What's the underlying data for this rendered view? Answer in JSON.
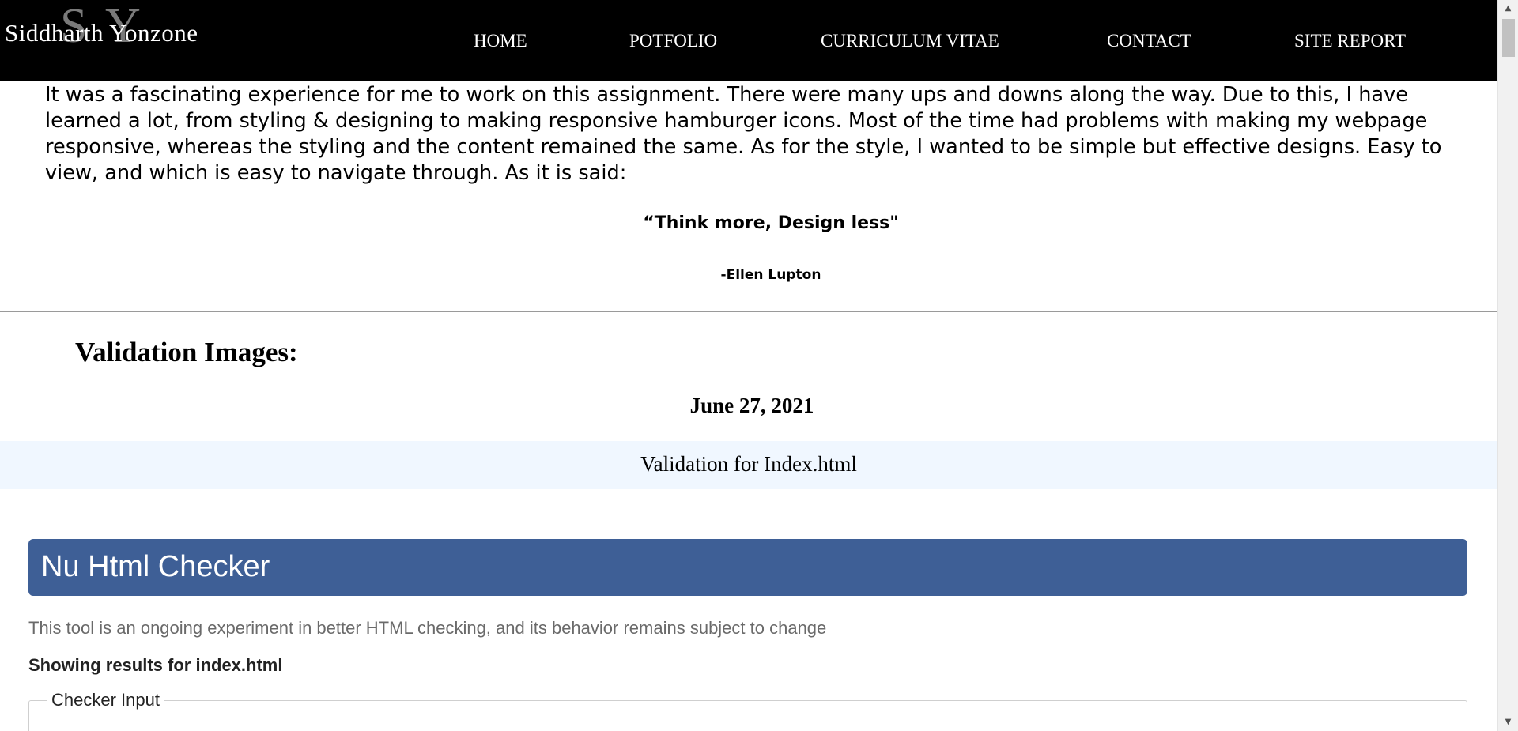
{
  "header": {
    "logo": {
      "letter_s": "S",
      "letter_y": "Y",
      "name_first": "Siddharth",
      "name_last": "Yonzone"
    },
    "nav": [
      {
        "label": "HOME"
      },
      {
        "label": "POTFOLIO"
      },
      {
        "label": "CURRICULUM VITAE"
      },
      {
        "label": "CONTACT"
      },
      {
        "label": "SITE REPORT"
      }
    ]
  },
  "reflection": {
    "text": "It was a fascinating experience for me to work on this assignment. There were many ups and downs along the way. Due to this, I have learned a lot, from styling & designing to making responsive hamburger icons. Most of the time had problems with making my webpage responsive, whereas the styling and the content remained the same. As for the style, I wanted to be simple but effective designs. Easy to view, and which is easy to navigate through. As it is said:",
    "quote": "“Think more, Design less\"",
    "author": "-Ellen Lupton"
  },
  "validation": {
    "heading": "Validation Images:",
    "date": "June 27, 2021",
    "band_title": "Validation for Index.html",
    "checker": {
      "title": "Nu Html Checker",
      "note": "This tool is an ongoing experiment in better HTML checking, and its behavior remains subject to change",
      "results": "Showing results for index.html",
      "input_legend": "Checker Input"
    }
  },
  "colors": {
    "header_bg": "#000000",
    "band_bg": "#f0f7ff",
    "checker_banner": "#3e5f96"
  },
  "icons": {
    "scroll_up": "scroll-up-arrow-icon",
    "scroll_down": "scroll-down-arrow-icon"
  }
}
